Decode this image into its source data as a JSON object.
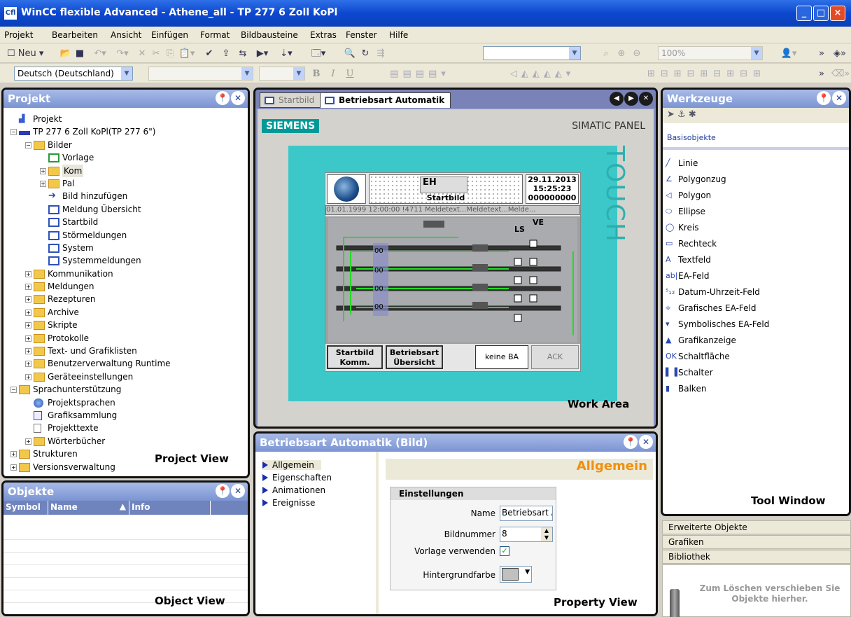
{
  "app": {
    "title": "WinCC flexible Advanced - Athene_all - TP 277 6 Zoll KoPl",
    "icon_text": "Cfl"
  },
  "window_controls": {
    "minimize": "_",
    "maximize": "□",
    "close": "×"
  },
  "menu": [
    "Projekt",
    "Bearbeiten",
    "Ansicht",
    "Einfügen",
    "Format",
    "Bildbausteine",
    "Extras",
    "Fenster",
    "Hilfe"
  ],
  "toolbar1": {
    "new_label": "Neu",
    "zoom": "100%"
  },
  "toolbar2": {
    "language": "Deutsch (Deutschland)",
    "font_bold": "B",
    "font_italic": "I",
    "font_underline": "U"
  },
  "project_view": {
    "title": "Projekt",
    "label": "Project View",
    "tree": [
      {
        "label": "Projekt",
        "level": 0,
        "exp": "",
        "icon": "project"
      },
      {
        "label": "TP 277 6 Zoll KoPl(TP 277 6\")",
        "level": 0,
        "exp": "-",
        "icon": "device"
      },
      {
        "label": "Bilder",
        "level": 1,
        "exp": "-",
        "icon": "folder"
      },
      {
        "label": "Vorlage",
        "level": 2,
        "exp": "",
        "icon": "screen-green"
      },
      {
        "label": "Kom",
        "level": 2,
        "exp": "+",
        "icon": "folder",
        "selected": true
      },
      {
        "label": "Pal",
        "level": 2,
        "exp": "+",
        "icon": "folder"
      },
      {
        "label": "Bild hinzufügen",
        "level": 2,
        "exp": "",
        "icon": "add"
      },
      {
        "label": "Meldung Übersicht",
        "level": 2,
        "exp": "",
        "icon": "screen"
      },
      {
        "label": "Startbild",
        "level": 2,
        "exp": "",
        "icon": "screen"
      },
      {
        "label": "Störmeldungen",
        "level": 2,
        "exp": "",
        "icon": "screen"
      },
      {
        "label": "System",
        "level": 2,
        "exp": "",
        "icon": "screen"
      },
      {
        "label": "Systemmeldungen",
        "level": 2,
        "exp": "",
        "icon": "screen"
      },
      {
        "label": "Kommunikation",
        "level": 1,
        "exp": "+",
        "icon": "folder"
      },
      {
        "label": "Meldungen",
        "level": 1,
        "exp": "+",
        "icon": "folder"
      },
      {
        "label": "Rezepturen",
        "level": 1,
        "exp": "+",
        "icon": "folder"
      },
      {
        "label": "Archive",
        "level": 1,
        "exp": "+",
        "icon": "folder"
      },
      {
        "label": "Skripte",
        "level": 1,
        "exp": "+",
        "icon": "folder"
      },
      {
        "label": "Protokolle",
        "level": 1,
        "exp": "+",
        "icon": "folder"
      },
      {
        "label": "Text- und Grafiklisten",
        "level": 1,
        "exp": "+",
        "icon": "folder"
      },
      {
        "label": "Benutzerverwaltung Runtime",
        "level": 1,
        "exp": "+",
        "icon": "folder"
      },
      {
        "label": "Geräteeinstellungen",
        "level": 1,
        "exp": "+",
        "icon": "folder"
      },
      {
        "label": "Sprachunterstützung",
        "level": 0,
        "exp": "-",
        "icon": "folder"
      },
      {
        "label": "Projektsprachen",
        "level": 1,
        "exp": "",
        "icon": "globe"
      },
      {
        "label": "Grafiksammlung",
        "level": 1,
        "exp": "",
        "icon": "graphic"
      },
      {
        "label": "Projekttexte",
        "level": 1,
        "exp": "",
        "icon": "doc"
      },
      {
        "label": "Wörterbücher",
        "level": 1,
        "exp": "+",
        "icon": "folder"
      },
      {
        "label": "Strukturen",
        "level": 0,
        "exp": "+",
        "icon": "folder"
      },
      {
        "label": "Versionsverwaltung",
        "level": 0,
        "exp": "+",
        "icon": "folder"
      }
    ]
  },
  "object_view": {
    "title": "Objekte",
    "label": "Object View",
    "columns": [
      "Symbol",
      "Name",
      "Info"
    ]
  },
  "work_area": {
    "label": "Work Area",
    "tabs": [
      {
        "label": "Startbild",
        "active": false
      },
      {
        "label": "Betriebsart Automatik",
        "active": true
      }
    ],
    "brand": "SIEMENS",
    "panel_name": "SIMATIC PANEL",
    "touch": "TOUCH",
    "hmi": {
      "logo_text": "EH",
      "date": "29.11.2013",
      "time": "15:25:23",
      "screen_name": "Startbild",
      "counter": "000000000",
      "message_line": "01.01.1999 12:00:00 !4711 Meldetext...Meldetext...Melde...",
      "label_ls": "LS",
      "label_ve": "VE",
      "row_value": "00",
      "btn1": [
        "Startbild",
        "Komm."
      ],
      "btn2": [
        "Betriebsart",
        "Übersicht"
      ],
      "mode": "keine BA",
      "ack": "ACK"
    }
  },
  "property_view": {
    "title": "Betriebsart Automatik (Bild)",
    "label": "Property View",
    "items": [
      "Allgemein",
      "Eigenschaften",
      "Animationen",
      "Ereignisse"
    ],
    "section_title": "Allgemein",
    "group": "Einstellungen",
    "name_label": "Name",
    "name_value": "Betriebsart Aut",
    "number_label": "Bildnummer",
    "number_value": "8",
    "template_label": "Vorlage verwenden",
    "template_checked": "✓",
    "bg_label": "Hintergrundfarbe"
  },
  "tool_window": {
    "title": "Werkzeuge",
    "label": "Tool Window",
    "category": "Basisobjekte",
    "tools": [
      {
        "label": "Linie",
        "icon": "line-icon"
      },
      {
        "label": "Polygonzug",
        "icon": "polyline-icon"
      },
      {
        "label": "Polygon",
        "icon": "polygon-icon"
      },
      {
        "label": "Ellipse",
        "icon": "ellipse-icon"
      },
      {
        "label": "Kreis",
        "icon": "circle-icon"
      },
      {
        "label": "Rechteck",
        "icon": "rectangle-icon"
      },
      {
        "label": "Textfeld",
        "icon": "text-icon"
      },
      {
        "label": "EA-Feld",
        "icon": "io-field-icon"
      },
      {
        "label": "Datum-Uhrzeit-Feld",
        "icon": "datetime-icon"
      },
      {
        "label": "Grafisches EA-Feld",
        "icon": "graphic-io-icon"
      },
      {
        "label": "Symbolisches EA-Feld",
        "icon": "symbolic-io-icon"
      },
      {
        "label": "Grafikanzeige",
        "icon": "graphic-view-icon"
      },
      {
        "label": "Schaltfläche",
        "icon": "button-icon"
      },
      {
        "label": "Schalter",
        "icon": "switch-icon"
      },
      {
        "label": "Balken",
        "icon": "bar-icon"
      }
    ],
    "accordion": [
      "Erweiterte Objekte",
      "Grafiken",
      "Bibliothek"
    ],
    "trash_text": "Zum Löschen verschieben Sie Objekte hierher."
  }
}
